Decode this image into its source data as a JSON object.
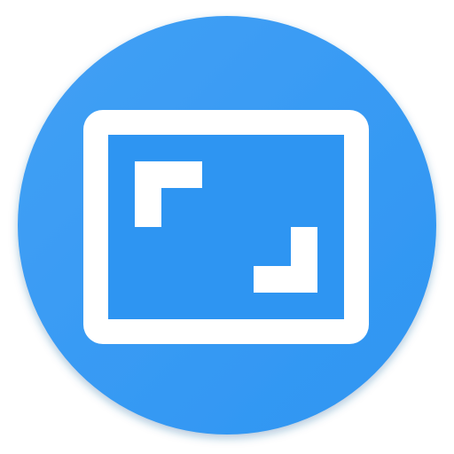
{
  "icon": {
    "name": "aspect-ratio-crop-icon",
    "colors": {
      "background": "#2e95f2",
      "background_highlight": "#42a0f5",
      "foreground": "#ffffff",
      "shadow": "#1f5f99"
    }
  }
}
